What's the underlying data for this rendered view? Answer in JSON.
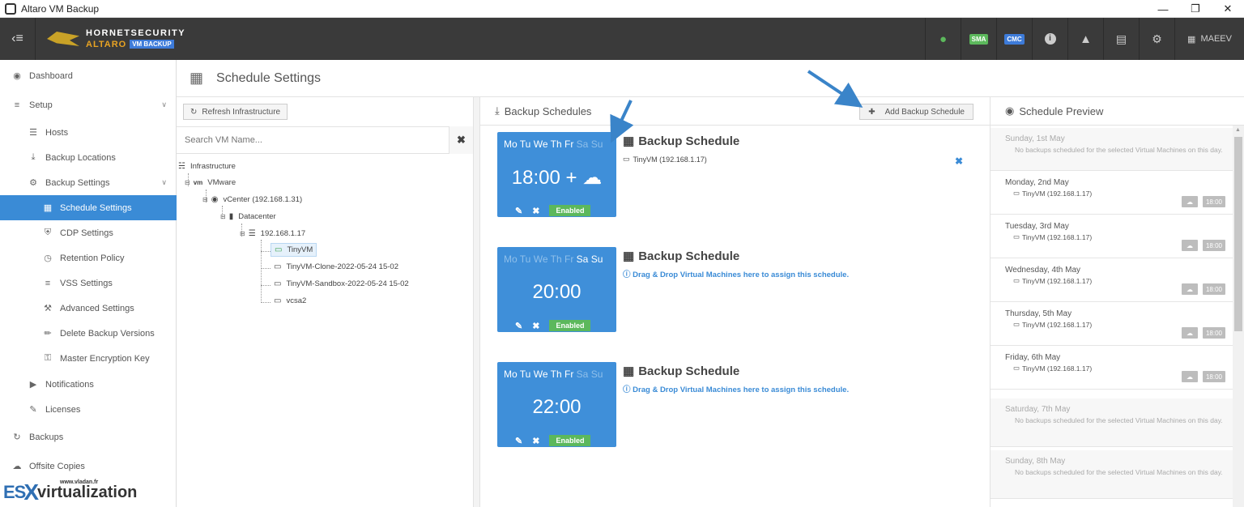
{
  "window": {
    "title": "Altaro VM Backup"
  },
  "header": {
    "brand_top": "HORNETSECURITY",
    "brand_name": "ALTARO",
    "brand_tag": "VM BACKUP",
    "sma": "SMA",
    "cmc": "CMC",
    "user": "MAEEV",
    "colors": {
      "bar": "#3a3a3a",
      "sma": "#5cb85c",
      "cmc": "#3d7bd9",
      "chat": "#5cb85c"
    }
  },
  "sidebar": {
    "dashboard": "Dashboard",
    "setup": "Setup",
    "hosts": "Hosts",
    "backup_locations": "Backup Locations",
    "backup_settings": "Backup Settings",
    "schedule_settings": "Schedule Settings",
    "cdp_settings": "CDP Settings",
    "retention_policy": "Retention Policy",
    "vss_settings": "VSS Settings",
    "advanced_settings": "Advanced Settings",
    "delete_backup_versions": "Delete Backup Versions",
    "master_encryption_key": "Master Encryption Key",
    "notifications": "Notifications",
    "licenses": "Licenses",
    "backups": "Backups",
    "offsite_copies": "Offsite Copies"
  },
  "page": {
    "title": "Schedule Settings"
  },
  "infra": {
    "refresh_label": "Refresh Infrastructure",
    "search_placeholder": "Search VM Name...",
    "tree": {
      "root": "Infrastructure",
      "vmware": "VMware",
      "vcenter": "vCenter (192.168.1.31)",
      "datacenter": "Datacenter",
      "host": "192.168.1.17",
      "vm1": "TinyVM",
      "vm2": "TinyVM-Clone-2022-05-24 15-02",
      "vm3": "TinyVM-Sandbox-2022-05-24 15-02",
      "vm4": "vcsa2"
    }
  },
  "schedules": {
    "title": "Backup Schedules",
    "add_label": "Add Backup Schedule",
    "days": [
      "Mo",
      "Tu",
      "We",
      "Th",
      "Fr",
      "Sa",
      "Su"
    ],
    "items": [
      {
        "time": "18:00 +",
        "status": "Enabled",
        "title": "Backup Schedule",
        "vm": "TinyVM (192.168.1.17)",
        "active_days": [
          true,
          true,
          true,
          true,
          true,
          false,
          false
        ]
      },
      {
        "time": "20:00",
        "status": "Enabled",
        "title": "Backup Schedule",
        "hint": "Drag & Drop Virtual Machines here to assign this schedule.",
        "active_days": [
          false,
          false,
          false,
          false,
          false,
          true,
          true
        ]
      },
      {
        "time": "22:00",
        "status": "Enabled",
        "title": "Backup Schedule",
        "hint": "Drag & Drop Virtual Machines here to assign this schedule.",
        "active_days": [
          true,
          true,
          true,
          true,
          true,
          false,
          false
        ]
      }
    ]
  },
  "preview": {
    "title": "Schedule Preview",
    "items": [
      {
        "date": "Sunday, 1st May",
        "note": "No backups scheduled for the selected Virtual Machines on this day."
      },
      {
        "date": "Monday, 2nd May",
        "vm": "TinyVM (192.168.1.17)",
        "time": "18:00"
      },
      {
        "date": "Tuesday, 3rd May",
        "vm": "TinyVM (192.168.1.17)",
        "time": "18:00"
      },
      {
        "date": "Wednesday, 4th May",
        "vm": "TinyVM (192.168.1.17)",
        "time": "18:00"
      },
      {
        "date": "Thursday, 5th May",
        "vm": "TinyVM (192.168.1.17)",
        "time": "18:00"
      },
      {
        "date": "Friday, 6th May",
        "vm": "TinyVM (192.168.1.17)",
        "time": "18:00"
      },
      {
        "date": "Saturday, 7th May",
        "note": "No backups scheduled for the selected Virtual Machines on this day."
      },
      {
        "date": "Sunday, 8th May",
        "note": "No backups scheduled for the selected Virtual Machines on this day."
      }
    ]
  },
  "watermark": {
    "es": "ES",
    "x": "X",
    "rest": "virtualization",
    "url": "www.vladan.fr"
  }
}
